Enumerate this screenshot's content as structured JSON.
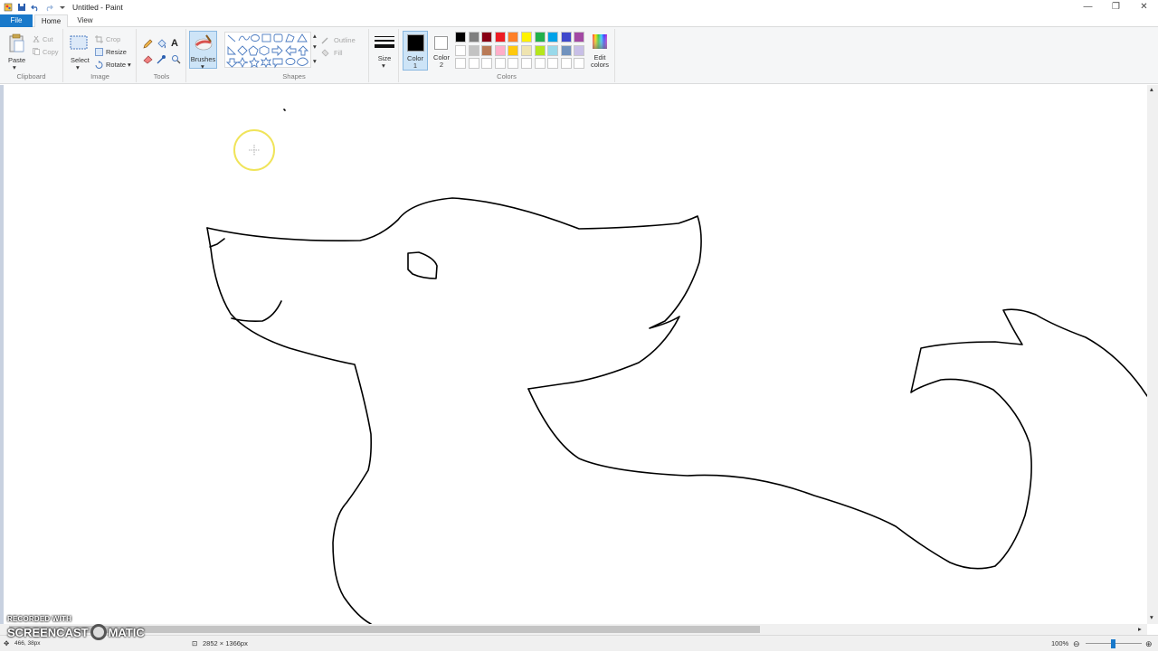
{
  "window": {
    "title": "Untitled - Paint",
    "controls": {
      "minimize": "—",
      "restore": "❐",
      "close": "✕"
    }
  },
  "tabs": [
    {
      "label": "File"
    },
    {
      "label": "Home"
    },
    {
      "label": "View"
    }
  ],
  "ribbon": {
    "clipboard": {
      "paste": "Paste",
      "cut": "Cut",
      "copy": "Copy",
      "group": "Clipboard"
    },
    "image": {
      "select": "Select",
      "crop": "Crop",
      "resize": "Resize",
      "rotate": "Rotate",
      "group": "Image"
    },
    "tools": {
      "group": "Tools"
    },
    "brushes": {
      "label": "Brushes"
    },
    "shapes": {
      "outline": "Outline",
      "fill": "Fill",
      "group": "Shapes"
    },
    "size": {
      "label": "Size"
    },
    "color1": {
      "label": "Color",
      "sub": "1"
    },
    "color2": {
      "label": "Color",
      "sub": "2"
    },
    "edit_colors": {
      "label1": "Edit",
      "label2": "colors"
    },
    "colors_group": "Colors"
  },
  "palette": [
    "#000000",
    "#7f7f7f",
    "#880015",
    "#ed1c24",
    "#ff7f27",
    "#fff200",
    "#22b14c",
    "#00a2e8",
    "#3f48cc",
    "#a349a4",
    "#ffffff",
    "#c3c3c3",
    "#b97a57",
    "#ffaec9",
    "#ffc90e",
    "#efe4b0",
    "#b5e61d",
    "#99d9ea",
    "#7092be",
    "#c8bfe7"
  ],
  "status": {
    "cursor_pos": "466, 38px",
    "canvas_size": "2852 × 1366px",
    "zoom": "100%"
  },
  "watermark": {
    "line1": "RECORDED WITH",
    "line2a": "SCREENCAST",
    "line2b": "MATIC"
  }
}
